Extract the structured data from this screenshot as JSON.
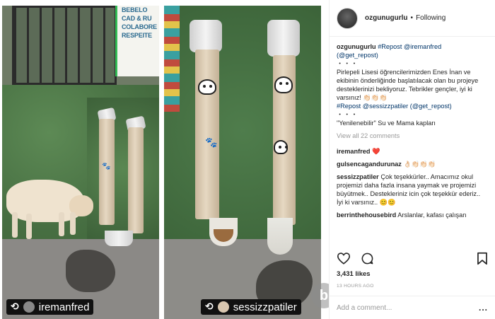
{
  "post": {
    "author": "ozgunugurlu",
    "separator": "•",
    "follow_status": "Following"
  },
  "photo": {
    "left_stamp": "iremanfred",
    "right_stamp": "sessizzpatiler",
    "left_sign": [
      "BEBELO",
      "CAD & RU",
      "COLABORE",
      "RESPEITE"
    ]
  },
  "caption": {
    "author": "ozgunugurlu",
    "tags_line1": "#Repost @iremanfred",
    "tags_line2": "(@get_repost)",
    "dots": "・・・",
    "text": "Pirlepeli Lisesi öğrencilerimizden Enes İnan ve ekibinin önderliğinde başlatılacak olan bu projeye desteklerinizi bekliyoruz. Tebrikler gençler, iyi ki varsınız! 👏🏻👏🏻👏🏻",
    "tags_line3": "#Repost @sessizzpatiler (@get_repost)",
    "dots2": "・・・",
    "quote": "\"Yenilenebilir\" Su ve Mama kapları"
  },
  "view_all": "View all 22 comments",
  "comments": [
    {
      "user": "iremanfred",
      "text": "❤️"
    },
    {
      "user": "gulsencagandurunaz",
      "text": "👌🏻👏🏻👏🏻👏🏻"
    },
    {
      "user": "sessizzpatiler",
      "text": "Çok teşekkürler.. Amacımız okul projemizi daha fazla insana yaymak ve projemizi büyütmek.. Destekleriniz icin çok teşekkür ederiz.. İyi ki varsınız.. 😊😊"
    },
    {
      "user": "berrinthehousebird",
      "text": "Arslanlar, kafası çalışan"
    }
  ],
  "likes": "3,431 likes",
  "timestamp": "13 HOURS AGO",
  "add_comment": {
    "placeholder": "Add a comment...",
    "more": "..."
  },
  "watermark": "b",
  "colors": {
    "link": "#003569",
    "muted": "#999999",
    "text": "#262626"
  },
  "icons": [
    "heart-icon",
    "comment-icon",
    "bookmark-icon",
    "repost-icon"
  ]
}
